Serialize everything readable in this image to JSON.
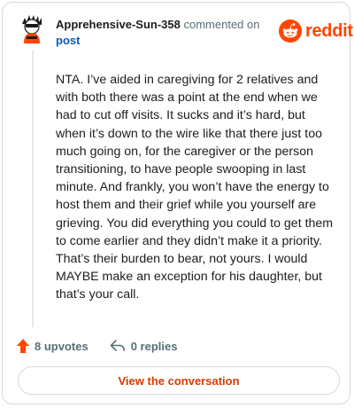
{
  "comment": {
    "username": "Apprehensive-Sun-358",
    "action_text": " commented on ",
    "target_link": "post",
    "body": "NTA. I’ve aided in caregiving for 2 relatives and with both there was a point at the end when we had to cut off visits. It sucks and it’s hard, but when it’s down to the wire like that there just too much going on, for the caregiver or the person transitioning, to have people swooping in last minute. And frankly, you won’t have the energy to host them and their grief while you yourself are grieving. You did everything you could to get them to come earlier and they didn’t make it a priority. That’s their burden to bear, not yours. I would MAYBE make an exception for his daughter, but that’s your call.",
    "upvotes_label": "8 upvotes",
    "replies_label": "0 replies"
  },
  "brand": {
    "logo_text": "reddit",
    "accent_color": "#ff4500"
  },
  "cta": {
    "label": "View the conversation",
    "color": "#d93a00"
  },
  "icons": {
    "avatar": "avatar-icon",
    "logo": "reddit-snoo-icon",
    "upvote": "upvote-arrow-icon",
    "reply": "reply-arrow-icon"
  }
}
